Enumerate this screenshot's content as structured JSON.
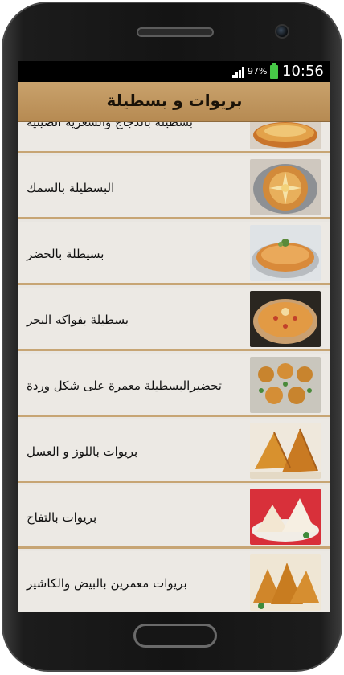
{
  "status_bar": {
    "battery_percent": "97%",
    "time": "10:56"
  },
  "app_bar": {
    "title": "بريوات و بسطيلة"
  },
  "recipes": [
    {
      "label": "بسطيلة بالدجاج والشعرية الصينية",
      "thumb_icon": "pastilla-chicken-image"
    },
    {
      "label": "البسطيلة بالسمك",
      "thumb_icon": "fish-pastilla-image"
    },
    {
      "label": "بسيطلة بالخضر",
      "thumb_icon": "vegetable-pastilla-image"
    },
    {
      "label": "بسطيلة بفواكه البحر",
      "thumb_icon": "seafood-pastilla-image"
    },
    {
      "label": "تحضيرالبسطيلة معمرة على شكل وردة",
      "thumb_icon": "rose-pastilla-image"
    },
    {
      "label": "بريوات باللوز و العسل",
      "thumb_icon": "almond-briouat-image"
    },
    {
      "label": "بريوات بالتفاح",
      "thumb_icon": "apple-briouat-image"
    },
    {
      "label": "بريوات معمرين بالبيض والكاشير",
      "thumb_icon": "egg-cachir-briouat-image"
    }
  ]
}
